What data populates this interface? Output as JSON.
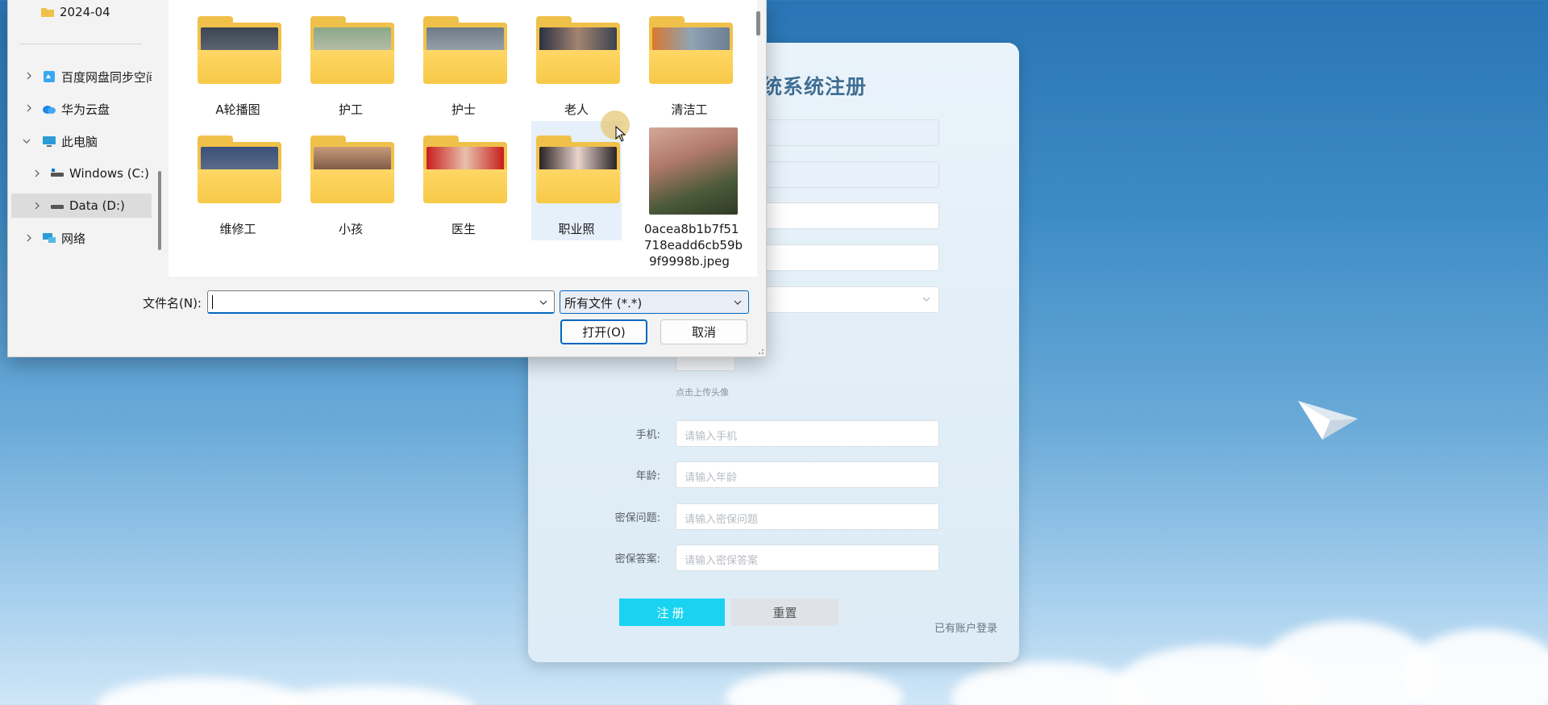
{
  "register": {
    "title": "统系统注册",
    "upload_hint": "点击上传头像",
    "fields": [
      {
        "label": "手机:",
        "placeholder": "请输入手机"
      },
      {
        "label": "年龄:",
        "placeholder": "请输入年龄"
      },
      {
        "label": "密保问题:",
        "placeholder": "请输入密保问题"
      },
      {
        "label": "密保答案:",
        "placeholder": "请输入密保答案"
      }
    ],
    "register_button": "注册",
    "reset_button": "重置",
    "login_link": "已有账户登录",
    "accent_color": "#19d3f0"
  },
  "dialog": {
    "nav": {
      "folder_2024": "2024-04",
      "baidu": "百度网盘同步空间",
      "huawei": "华为云盘",
      "this_pc": "此电脑",
      "windows_c": "Windows (C:)",
      "data_d": "Data (D:)",
      "network": "网络"
    },
    "items": [
      {
        "label": "A轮播图",
        "type": "folder"
      },
      {
        "label": "护工",
        "type": "folder"
      },
      {
        "label": "护士",
        "type": "folder"
      },
      {
        "label": "老人",
        "type": "folder"
      },
      {
        "label": "清洁工",
        "type": "folder"
      },
      {
        "label": "维修工",
        "type": "folder"
      },
      {
        "label": "小孩",
        "type": "folder"
      },
      {
        "label": "医生",
        "type": "folder"
      },
      {
        "label": "职业照",
        "type": "folder"
      },
      {
        "label": "0acea8b1b7f51718eadd6cb59b9f9998b.jpeg",
        "type": "image",
        "lines": [
          "0acea8b1b7f51",
          "718eadd6cb59b",
          "9f9998b.jpeg"
        ]
      }
    ],
    "filename_label": "文件名(N):",
    "filename_value": "",
    "filetype_value": "所有文件 (*.*)",
    "open_button": "打开(O)",
    "cancel_button": "取消"
  }
}
